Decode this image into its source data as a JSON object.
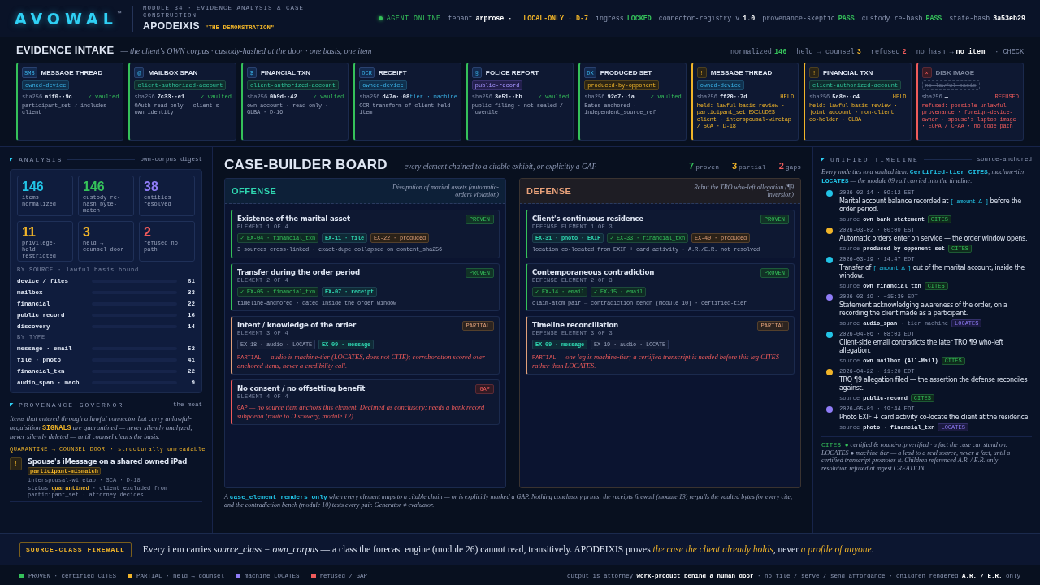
{
  "header": {
    "brand": "AVOWAL",
    "brand_mark": "™",
    "module": "MODULE 34 · EVIDENCE ANALYSIS & CASE CONSTRUCTION",
    "title": "APODEIXIS",
    "subtitle": "\"THE DEMONSTRATION\"",
    "agent": "AGENT ONLINE",
    "items": [
      {
        "label": "tenant",
        "value": "arprose · ",
        "color": "#ffffff"
      },
      {
        "value": "LOCAL-ONLY · D-7",
        "color": "#f0b429"
      },
      {
        "label": "ingress",
        "value": "LOCKED",
        "color": "#35c15a"
      },
      {
        "label": "connector-registry v",
        "value": "1.0",
        "color": "#ffffff"
      },
      {
        "label": "provenance-skeptic",
        "value": "PASS",
        "color": "#35c15a"
      },
      {
        "label": "custody re-hash",
        "value": "PASS",
        "color": "#35c15a"
      },
      {
        "label": "state-hash",
        "value": "3a53eb29",
        "color": "#ffffff"
      }
    ]
  },
  "intake": {
    "title": "EVIDENCE INTAKE",
    "subtitle": "— the client's OWN corpus · custody-hashed at the door · one basis, one item",
    "stats": [
      {
        "label": "normalized",
        "value": "146",
        "color": "#35c15a"
      },
      {
        "label": "held → counsel",
        "value": "3",
        "color": "#f0b429"
      },
      {
        "label": "refused",
        "value": "2",
        "color": "#ef5b5b"
      },
      {
        "label": "no hash →",
        "value": "no item",
        "color": "#ffffff"
      },
      {
        "label": "· CHECK"
      }
    ],
    "cards": [
      {
        "kind": "vaulted",
        "icon": "SMS",
        "title": "MESSAGE THREAD",
        "tag": {
          "label": "owned-device",
          "kind": "device"
        },
        "hash_label": "sha256",
        "hash": "a1f0··9c",
        "state": "✓ vaulted",
        "note": "participant_set ✓ includes client"
      },
      {
        "kind": "vaulted",
        "icon": "@",
        "title": "MAILBOX SPAN",
        "tag": {
          "label": "client-authorized-account",
          "kind": "account"
        },
        "hash_label": "sha256",
        "hash": "7c33··e1",
        "state": "✓ vaulted",
        "note": "OAuth read-only · client's own identity"
      },
      {
        "kind": "vaulted",
        "icon": "$",
        "title": "FINANCIAL TXN",
        "tag": {
          "label": "client-authorized-account",
          "kind": "account"
        },
        "hash_label": "sha256",
        "hash": "0b9d··42",
        "state": "✓ vaulted",
        "note": "own account · read-only · GLBA · D-16"
      },
      {
        "kind": "machine",
        "icon": "OCR",
        "title": "RECEIPT",
        "tag": {
          "label": "owned-device",
          "kind": "device"
        },
        "hash_label": "sha256",
        "hash": "d47a··08",
        "state": "tier · machine",
        "note": "OCR transform of client-held item"
      },
      {
        "kind": "vaulted",
        "icon": "§",
        "title": "POLICE REPORT",
        "tag": {
          "label": "public-record",
          "kind": "public"
        },
        "hash_label": "sha256",
        "hash": "3e51··bb",
        "state": "✓ vaulted",
        "note": "public filing · not sealed / juvenile"
      },
      {
        "kind": "vaulted",
        "icon": "DX",
        "title": "PRODUCED SET",
        "tag": {
          "label": "produced-by-opponent",
          "kind": "produced"
        },
        "hash_label": "sha256",
        "hash": "92c7··1a",
        "state": "✓ vaulted",
        "note": "Bates-anchored · independent_source_ref"
      },
      {
        "kind": "held",
        "icon": "!",
        "title": "MESSAGE THREAD",
        "tag": {
          "label": "owned-device",
          "kind": "device"
        },
        "hash_label": "sha256",
        "hash": "ff20··7d",
        "state": "HELD",
        "note": "held: lawful-basis review · participant_set EXCLUDES client · interspousal-wiretap / SCA · D-18"
      },
      {
        "kind": "held",
        "icon": "!",
        "title": "FINANCIAL TXN",
        "tag": {
          "label": "client-authorized-account",
          "kind": "account"
        },
        "hash_label": "sha256",
        "hash": "5a8e··c4",
        "state": "HELD",
        "note": "held: lawful-basis review · joint account · non-client co-holder · GLBA"
      },
      {
        "kind": "refused",
        "icon": "×",
        "title": "DISK IMAGE",
        "tag": {
          "label": "no-lawful-basis",
          "kind": "struck"
        },
        "hash_label": "sha256",
        "hash": "—",
        "state": "REFUSED",
        "note": "refused: possible unlawful provenance · foreign-device-owner · spouse's laptop image · ECPA / CFAA · no code path"
      }
    ]
  },
  "analysis": {
    "title": "ANALYSIS",
    "aside": "own-corpus digest",
    "tiles": [
      {
        "value": "146",
        "label": "items normalized",
        "color": "#22c3e6"
      },
      {
        "value": "146",
        "label": "custody re-hash byte-match",
        "color": "#35c15a"
      },
      {
        "value": "38",
        "label": "entities resolved",
        "color": "#8f7cf7"
      },
      {
        "value": "11",
        "label": "privilege-held restricted",
        "color": "#f0b429"
      },
      {
        "value": "3",
        "label": "held → counsel door",
        "color": "#f0b429"
      },
      {
        "value": "2",
        "label": "refused no path",
        "color": "#ef5b5b"
      }
    ],
    "groups": [
      {
        "heading": "BY SOURCE · lawful basis bound",
        "rows": [
          {
            "label": "device / files",
            "value": "61"
          },
          {
            "label": "mailbox",
            "value": "33"
          },
          {
            "label": "financial",
            "value": "22"
          },
          {
            "label": "public record",
            "value": "16"
          },
          {
            "label": "discovery",
            "value": "14"
          }
        ]
      },
      {
        "heading": "BY TYPE",
        "rows": [
          {
            "label": "message · email",
            "value": "52"
          },
          {
            "label": "file · photo",
            "value": "41"
          },
          {
            "label": "financial_txn",
            "value": "22"
          },
          {
            "label": "audio_span · mach",
            "value": "9"
          }
        ]
      }
    ]
  },
  "governor": {
    "title": "PROVENANCE GOVERNOR",
    "aside": "the moat",
    "text": "Items that entered through a lawful connector but carry unlawful-acquisition **SIGNALS** are quarantined — never silently analyzed, never silently deleted — until counsel clears the basis.",
    "door": "QUARANTINE → COUNSEL DOOR",
    "door_note": "· structurally unreadable",
    "items": [
      {
        "icon": "!",
        "title": "Spouse's iMessage on a shared owned iPad",
        "tag": "participant-mismatch",
        "meta": "interspousal-wiretap · SCA · D-18",
        "status": "status **quarantined** · client excluded from participant_set · attorney decides"
      }
    ]
  },
  "board": {
    "title": "CASE-BUILDER BOARD",
    "subtitle": "— every element chained to a citable exhibit, or explicitly a GAP",
    "counts": [
      {
        "value": "7",
        "label": "proven",
        "color": "#35c15a"
      },
      {
        "value": "3",
        "label": "partial",
        "color": "#f0b429"
      },
      {
        "value": "2",
        "label": "gaps",
        "color": "#ef5b5b"
      }
    ],
    "columns": [
      {
        "kind": "offense",
        "title": "OFFENSE",
        "note": "Dissipation of marital assets (automatic-orders violation)",
        "elements": [
          {
            "kind": "proven",
            "title": "Existence of the marital asset",
            "sub": "ELEMENT 1 OF 4",
            "badge": "PROVEN",
            "exhibits": [
              {
                "label": "✓ EX-04 · financial_txn",
                "kind": "cited"
              },
              {
                "label": "EX-11 · file",
                "kind": "linked"
              },
              {
                "label": "EX-22 · produced",
                "kind": "produced"
              }
            ],
            "note": "3 sources cross-linked · exact-dupe collapsed on content_sha256"
          },
          {
            "kind": "proven",
            "title": "Transfer during the order period",
            "sub": "ELEMENT 2 OF 4",
            "badge": "PROVEN",
            "exhibits": [
              {
                "label": "✓ EX-05 · financial_txn",
                "kind": "cited"
              },
              {
                "label": "EX-07 · receipt",
                "kind": "linked"
              }
            ],
            "note": "timeline-anchored · dated inside the order window"
          },
          {
            "kind": "partial",
            "title": "Intent / knowledge of the order",
            "sub": "ELEMENT 3 OF 4",
            "badge": "PARTIAL",
            "exhibits": [
              {
                "label": "EX-18 · audio · LOCATE",
                "kind": "machine"
              },
              {
                "label": "EX-09 · message",
                "kind": "linked"
              }
            ],
            "note": "**PARTIAL** — audio is machine-tier (LOCATES, does not CITE); corroboration scored over anchored items, never a credibility call."
          },
          {
            "kind": "gap",
            "title": "No consent / no offsetting benefit",
            "sub": "ELEMENT 4 OF 4",
            "badge": "GAP",
            "note": "**GAP** — no source item anchors this element. Declined as conclusory; needs a bank record subpoena (route to Discovery, module 12)."
          }
        ]
      },
      {
        "kind": "defense",
        "title": "DEFENSE",
        "note": "Rebut the TRO who-left allegation (¶9 inversion)",
        "elements": [
          {
            "kind": "proven",
            "title": "Client's continuous residence",
            "sub": "DEFENSE ELEMENT 1 OF 3",
            "badge": "PROVEN",
            "exhibits": [
              {
                "label": "EX-31 · photo · EXIF",
                "kind": "linked"
              },
              {
                "label": "✓ EX-33 · financial_txn",
                "kind": "cited"
              },
              {
                "label": "EX-40 · produced",
                "kind": "produced"
              }
            ],
            "note": "location co-located from EXIF + card activity · A.R./E.R. not resolved"
          },
          {
            "kind": "proven",
            "title": "Contemporaneous contradiction",
            "sub": "DEFENSE ELEMENT 2 OF 3",
            "badge": "PROVEN",
            "exhibits": [
              {
                "label": "✓ EX-14 · email",
                "kind": "cited"
              },
              {
                "label": "✓ EX-15 · email",
                "kind": "cited"
              }
            ],
            "note": "claim-atom pair → contradiction bench (module 10) · certified-tier"
          },
          {
            "kind": "partial",
            "title": "Timeline reconciliation",
            "sub": "DEFENSE ELEMENT 3 OF 3",
            "badge": "PARTIAL",
            "exhibits": [
              {
                "label": "EX-09 · message",
                "kind": "linked"
              },
              {
                "label": "EX-19 · audio · LOCATE",
                "kind": "machine"
              }
            ],
            "note": "**PARTIAL** — one leg is machine-tier; a certified transcript is needed before this leg CITES rather than LOCATES."
          }
        ]
      }
    ],
    "footnote": "A **case_element renders only** when every element maps to a citable chain — or is explicitly marked a GAP. Nothing conclusory prints; the receipts firewall (module 13) re-pulls the vaulted bytes for every cite, and the contradiction bench (module 10) tests every pair. Generator ≠ evaluator."
  },
  "timeline": {
    "title": "UNIFIED TIMELINE",
    "aside": "source-anchored",
    "intro": "Every node ties to a vaulted item. **Certified-tier CITES**; machine-tier **LOCATES** — the module 09 rail carried into the timeline.",
    "events": [
      {
        "color": "#22c3e6",
        "time": "2026-02-14 · 09:12 EST",
        "text": "Marital account balance recorded at **[ amount Δ ]** before the order period.",
        "source_label": "source",
        "source": "own bank statement",
        "badge": {
          "label": "CITES",
          "kind": "cites"
        }
      },
      {
        "color": "#f0b429",
        "time": "2026-03-02 · 00:00 EST",
        "text": "Automatic orders enter on service — the order window opens.",
        "source_label": "source",
        "source": "produced-by-opponent set",
        "badge": {
          "label": "CITES",
          "kind": "cites"
        }
      },
      {
        "color": "#22c3e6",
        "time": "2026-03-19 · 14:47 EDT",
        "text": "Transfer of **[ amount Δ ]** out of the marital account, inside the window.",
        "source_label": "source",
        "source": "own financial_txn",
        "badge": {
          "label": "CITES",
          "kind": "cites"
        }
      },
      {
        "color": "#8f7cf7",
        "time": "2026-03-19 · ~15:30 EDT",
        "text": "Statement acknowledging awareness of the order, on a recording the client made as a participant.",
        "source_label": "source",
        "source": "audio_span",
        "tier": "· tier machine",
        "badge": {
          "label": "LOCATES",
          "kind": "locates"
        }
      },
      {
        "color": "#22c3e6",
        "time": "2026-04-06 · 08:03 EDT",
        "text": "Client-side email contradicts the later TRO ¶9 who-left allegation.",
        "source_label": "source",
        "source": "own mailbox (All-Mail)",
        "badge": {
          "label": "CITES",
          "kind": "cites"
        }
      },
      {
        "color": "#f0b429",
        "time": "2026-04-22 · 11:20 EDT",
        "text": "TRO ¶9 allegation filed — the assertion the defense reconciles against.",
        "source_label": "source",
        "source": "public-record",
        "badge": {
          "label": "CITES",
          "kind": "cites"
        }
      },
      {
        "color": "#8f7cf7",
        "time": "2026-05-01 · 19:44 EDT",
        "text": "Photo EXIF + card activity co-locate the client at the residence.",
        "source_label": "source",
        "source": "photo · financial_txn",
        "badge": {
          "label": "LOCATES",
          "kind": "locates"
        }
      }
    ],
    "legend": "**CITES ●** certified & round-trip verified · a fact the case can stand on. *LOCATES ●* machine-tier — a lead to a real source, never a fact, until a certified transcript promotes it. Children referenced A.R. / E.R. only — resolution refused at ingest CREATION."
  },
  "firewall": {
    "label": "SOURCE-CLASS FIREWALL",
    "text": "Every item carries *source_class = own_corpus* — a class the forecast engine (module 26) cannot read, transitively. APODEIXIS proves **the case the client already holds**, never **a profile of anyone**."
  },
  "legend": {
    "items": [
      {
        "color": "#35c15a",
        "label": "PROVEN · certified CITES"
      },
      {
        "color": "#f0b429",
        "label": "PARTIAL · held → counsel"
      },
      {
        "color": "#8f7cf7",
        "label": "machine LOCATES"
      },
      {
        "color": "#ef5b5b",
        "label": "refused / GAP"
      }
    ],
    "note": "output is attorney **work-product behind a human door** · no file / serve / send affordance · children rendered **A.R. / E.R.** only"
  }
}
